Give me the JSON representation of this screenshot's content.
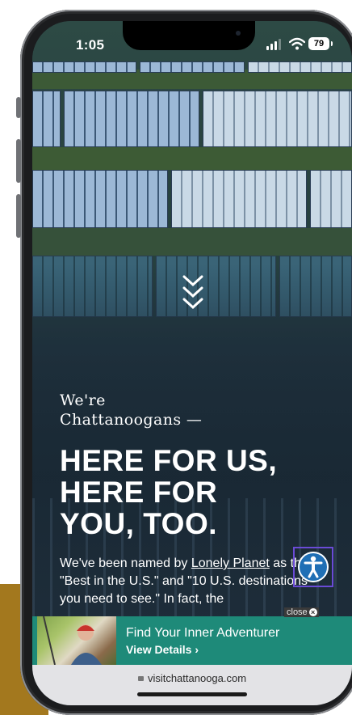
{
  "status_bar": {
    "time": "1:05",
    "battery": "79"
  },
  "hero": {
    "overline_line1": "We're",
    "overline_line2": "Chattanoogans —",
    "headline_line1": "HERE FOR US,",
    "headline_line2": "HERE FOR",
    "headline_line3": "YOU, TOO.",
    "body_prefix": "We've been named by ",
    "body_link": "Lonely Planet",
    "body_suffix": " as the \"Best in the U.S.\" and \"10 U.S. destinations you need to see.\" In fact, the"
  },
  "ad_banner": {
    "close_label": "close",
    "title": "Find Your Inner Adventurer",
    "cta": "View Details ›"
  },
  "browser": {
    "url": "visitchattanooga.com"
  },
  "icons": {
    "scroll": "chevron-down-icon",
    "accessibility": "accessibility-icon",
    "lock": "lock-icon"
  },
  "colors": {
    "banner_bg": "#1e8a79",
    "accessibility_blue": "#1f6fb5",
    "accent_gold": "#a3781e"
  }
}
